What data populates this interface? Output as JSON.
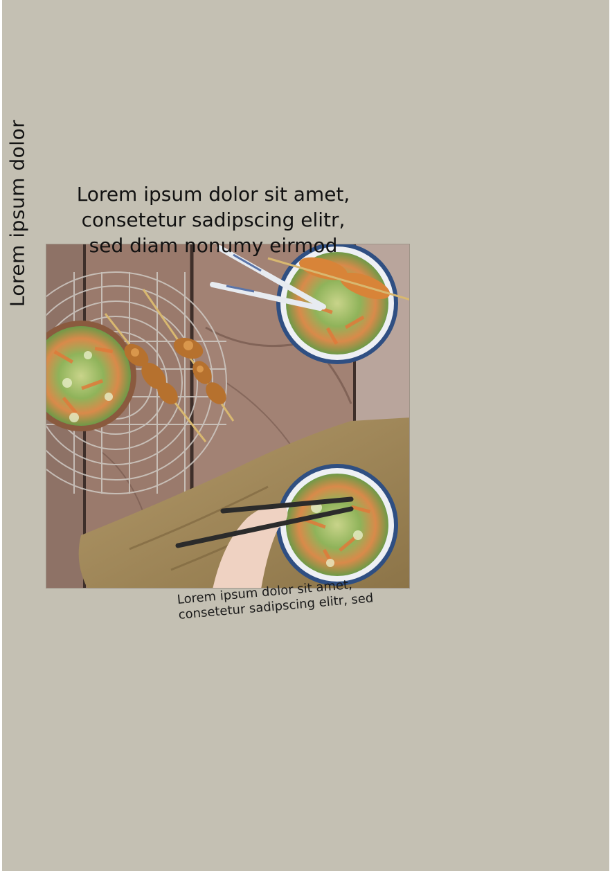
{
  "side_label": "Lorem ipsum dolor",
  "headline": {
    "line1": "Lorem ipsum dolor sit amet,",
    "line2": "consetetur sadipscing elitr,",
    "line3": "sed diam nonumy eirmod"
  },
  "photo": {
    "subject": "overhead photo of salad bowls and chicken skewers on a wooden table"
  },
  "caption": {
    "line1": "Lorem ipsum dolor sit amet,",
    "line2": "consetetur sadipscing elitr, sed"
  },
  "colors": {
    "page_background": "#c4c0b3",
    "text": "#141414"
  }
}
